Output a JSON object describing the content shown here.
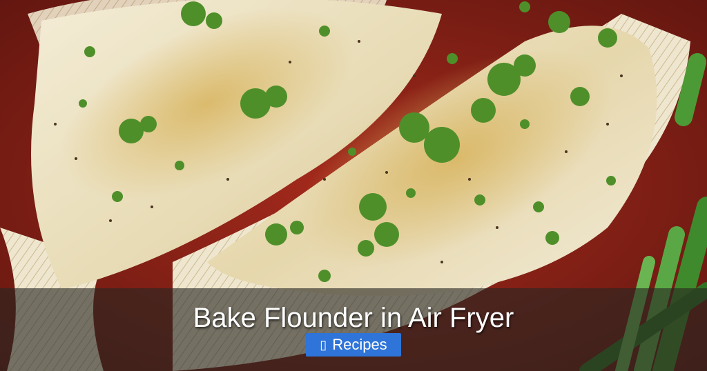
{
  "image": {
    "subject": "baked flounder fillets with parsley and green beans",
    "colors": {
      "plate": "#8e2217",
      "fish": "#ece4cb",
      "crust": "#d9b96a",
      "herb": "#4f8f2a",
      "beans": "#3f8a2c"
    }
  },
  "caption": {
    "title": "Bake Flounder in Air Fryer",
    "category": {
      "icon": "folder-icon",
      "icon_glyph": "▯",
      "label": "Recipes",
      "color": "#2f74d8"
    }
  }
}
